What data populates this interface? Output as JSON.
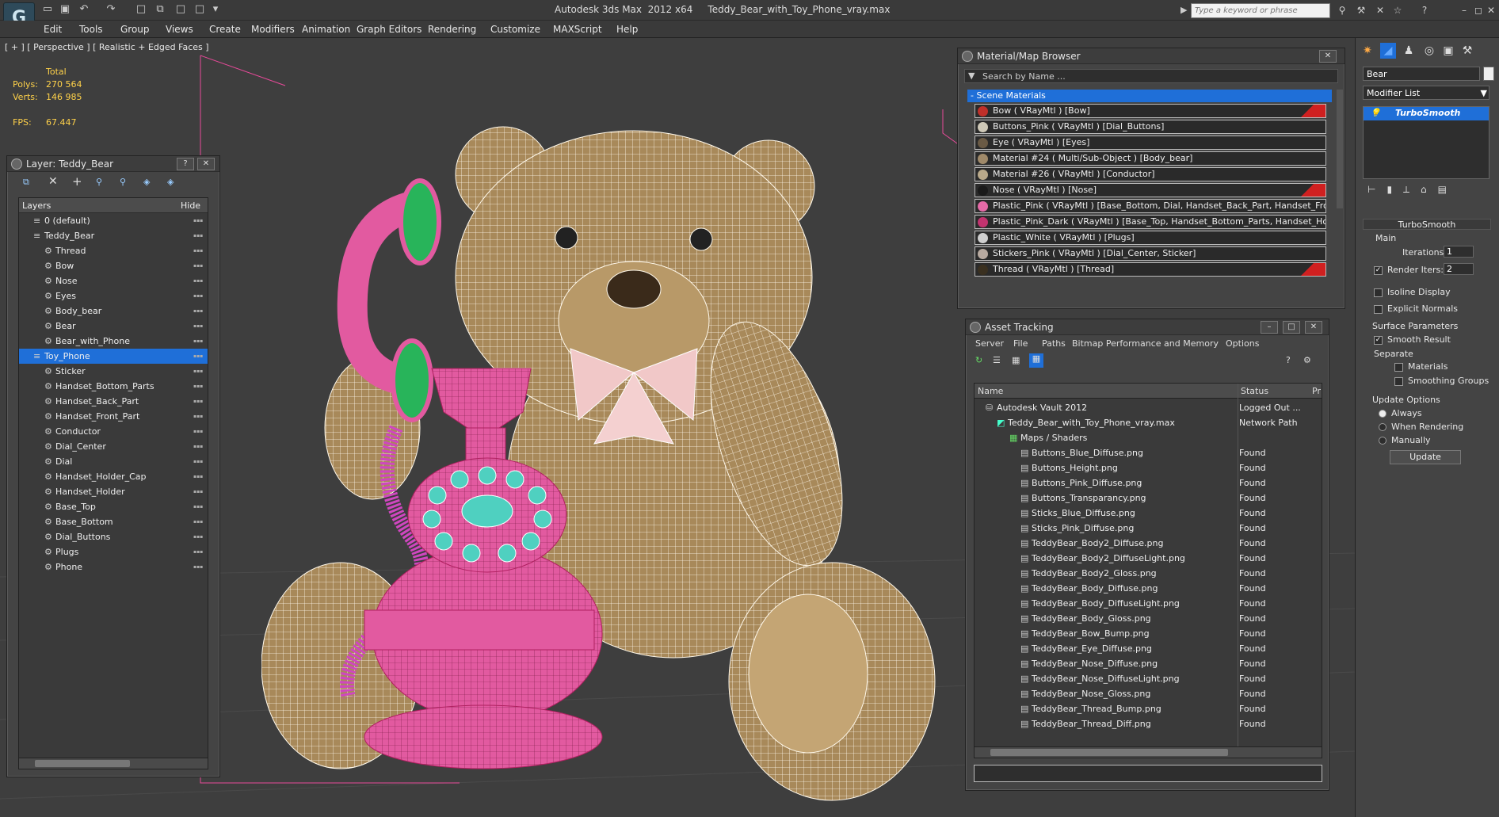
{
  "app": {
    "title": "Autodesk 3ds Max  2012 x64     Teddy_Bear_with_Toy_Phone_vray.max",
    "search_placeholder": "Type a keyword or phrase"
  },
  "menu": [
    "Edit",
    "Tools",
    "Group",
    "Views",
    "Create",
    "Modifiers",
    "Animation",
    "Graph Editors",
    "Rendering",
    "Customize",
    "MAXScript",
    "Help"
  ],
  "viewport": {
    "label": "[ + ] [ Perspective ] [ Realistic + Edged Faces ]",
    "stats": {
      "total": "Total",
      "polys_label": "Polys:",
      "polys": "270 564",
      "verts_label": "Verts:",
      "verts": "146 985",
      "fps_label": "FPS:",
      "fps": "67.447"
    }
  },
  "layer_panel": {
    "title": "Layer: Teddy_Bear",
    "col_layers": "Layers",
    "col_hide": "Hide",
    "rows": [
      {
        "name": "0 (default)",
        "level": 0
      },
      {
        "name": "Teddy_Bear",
        "level": 0
      },
      {
        "name": "Thread",
        "level": 1
      },
      {
        "name": "Bow",
        "level": 1
      },
      {
        "name": "Nose",
        "level": 1
      },
      {
        "name": "Eyes",
        "level": 1
      },
      {
        "name": "Body_bear",
        "level": 1
      },
      {
        "name": "Bear",
        "level": 1
      },
      {
        "name": "Bear_with_Phone",
        "level": 1
      },
      {
        "name": "Toy_Phone",
        "level": 0
      },
      {
        "name": "Sticker",
        "level": 1
      },
      {
        "name": "Handset_Bottom_Parts",
        "level": 1
      },
      {
        "name": "Handset_Back_Part",
        "level": 1
      },
      {
        "name": "Handset_Front_Part",
        "level": 1
      },
      {
        "name": "Conductor",
        "level": 1
      },
      {
        "name": "Dial_Center",
        "level": 1
      },
      {
        "name": "Dial",
        "level": 1
      },
      {
        "name": "Handset_Holder_Cap",
        "level": 1
      },
      {
        "name": "Handset_Holder",
        "level": 1
      },
      {
        "name": "Base_Top",
        "level": 1
      },
      {
        "name": "Base_Bottom",
        "level": 1
      },
      {
        "name": "Dial_Buttons",
        "level": 1
      },
      {
        "name": "Plugs",
        "level": 1
      },
      {
        "name": "Phone",
        "level": 1
      }
    ]
  },
  "material_browser": {
    "title": "Material/Map Browser",
    "search_placeholder": "Search by Name ...",
    "section": "- Scene Materials",
    "items": [
      {
        "label": "Bow  ( VRayMtl )  [Bow]",
        "swatch": "#c0302a",
        "red": true
      },
      {
        "label": "Buttons_Pink  ( VRayMtl )  [Dial_Buttons]",
        "swatch": "#cfc9b8",
        "red": false
      },
      {
        "label": "Eye  ( VRayMtl )  [Eyes]",
        "swatch": "#6a5a45",
        "red": false
      },
      {
        "label": "Material #24  ( Multi/Sub-Object )  [Body_bear]",
        "swatch": "#a08a6a",
        "red": false
      },
      {
        "label": "Material #26  ( VRayMtl )  [Conductor]",
        "swatch": "#b9a98a",
        "red": false
      },
      {
        "label": "Nose  ( VRayMtl )  [Nose]",
        "swatch": "#1a1a1a",
        "red": true
      },
      {
        "label": "Plastic_Pink  ( VRayMtl )  [Base_Bottom, Dial, Handset_Back_Part, Handset_Fron...",
        "swatch": "#e56aa7",
        "red": false
      },
      {
        "label": "Plastic_Pink_Dark  ( VRayMtl )  [Base_Top, Handset_Bottom_Parts, Handset_Hol...",
        "swatch": "#c2336f",
        "red": false
      },
      {
        "label": "Plastic_White  ( VRayMtl )  [Plugs]",
        "swatch": "#cfcfcf",
        "red": false
      },
      {
        "label": "Stickers_Pink  ( VRayMtl )  [Dial_Center, Sticker]",
        "swatch": "#b8aaa0",
        "red": false
      },
      {
        "label": "Thread  ( VRayMtl )  [Thread]",
        "swatch": "#3a3020",
        "red": true
      }
    ]
  },
  "asset_tracking": {
    "title": "Asset Tracking",
    "menu": [
      "Server",
      "File",
      "Paths",
      "Bitmap Performance and Memory",
      "Options"
    ],
    "col_name": "Name",
    "col_status": "Status",
    "col_pr": "Pr",
    "rows": [
      {
        "name": "Autodesk Vault 2012",
        "status": "Logged Out ...",
        "level": 0
      },
      {
        "name": "Teddy_Bear_with_Toy_Phone_vray.max",
        "status": "Network Path",
        "level": 1
      },
      {
        "name": "Maps / Shaders",
        "status": "",
        "level": 2
      },
      {
        "name": "Buttons_Blue_Diffuse.png",
        "status": "Found",
        "level": 3
      },
      {
        "name": "Buttons_Height.png",
        "status": "Found",
        "level": 3
      },
      {
        "name": "Buttons_Pink_Diffuse.png",
        "status": "Found",
        "level": 3
      },
      {
        "name": "Buttons_Transparancy.png",
        "status": "Found",
        "level": 3
      },
      {
        "name": "Sticks_Blue_Diffuse.png",
        "status": "Found",
        "level": 3
      },
      {
        "name": "Sticks_Pink_Diffuse.png",
        "status": "Found",
        "level": 3
      },
      {
        "name": "TeddyBear_Body2_Diffuse.png",
        "status": "Found",
        "level": 3
      },
      {
        "name": "TeddyBear_Body2_DiffuseLight.png",
        "status": "Found",
        "level": 3
      },
      {
        "name": "TeddyBear_Body2_Gloss.png",
        "status": "Found",
        "level": 3
      },
      {
        "name": "TeddyBear_Body_Diffuse.png",
        "status": "Found",
        "level": 3
      },
      {
        "name": "TeddyBear_Body_DiffuseLight.png",
        "status": "Found",
        "level": 3
      },
      {
        "name": "TeddyBear_Body_Gloss.png",
        "status": "Found",
        "level": 3
      },
      {
        "name": "TeddyBear_Bow_Bump.png",
        "status": "Found",
        "level": 3
      },
      {
        "name": "TeddyBear_Eye_Diffuse.png",
        "status": "Found",
        "level": 3
      },
      {
        "name": "TeddyBear_Nose_Diffuse.png",
        "status": "Found",
        "level": 3
      },
      {
        "name": "TeddyBear_Nose_DiffuseLight.png",
        "status": "Found",
        "level": 3
      },
      {
        "name": "TeddyBear_Nose_Gloss.png",
        "status": "Found",
        "level": 3
      },
      {
        "name": "TeddyBear_Thread_Bump.png",
        "status": "Found",
        "level": 3
      },
      {
        "name": "TeddyBear_Thread_Diff.png",
        "status": "Found",
        "level": 3
      }
    ]
  },
  "command_panel": {
    "object_name": "Bear",
    "modifier_list": "Modifier List",
    "stack_item": "TurboSmooth",
    "rollout": "TurboSmooth",
    "main": "Main",
    "iterations_label": "Iterations:",
    "iterations": "1",
    "render_iters_label": "Render Iters:",
    "render_iters": "2",
    "isoline": "Isoline Display",
    "explicit": "Explicit Normals",
    "surface": "Surface Parameters",
    "smooth_result": "Smooth Result",
    "separate": "Separate",
    "materials": "Materials",
    "smoothing_groups": "Smoothing Groups",
    "update_options": "Update Options",
    "always": "Always",
    "when_rendering": "When Rendering",
    "manually": "Manually",
    "update": "Update"
  },
  "colors": {
    "accent": "#1f6fd8",
    "bear_wire": "#fff8ea",
    "bear_fill": "#a8895a",
    "pink": "#e25aa0",
    "teal": "#4fd0c0",
    "green": "#28b45a"
  }
}
